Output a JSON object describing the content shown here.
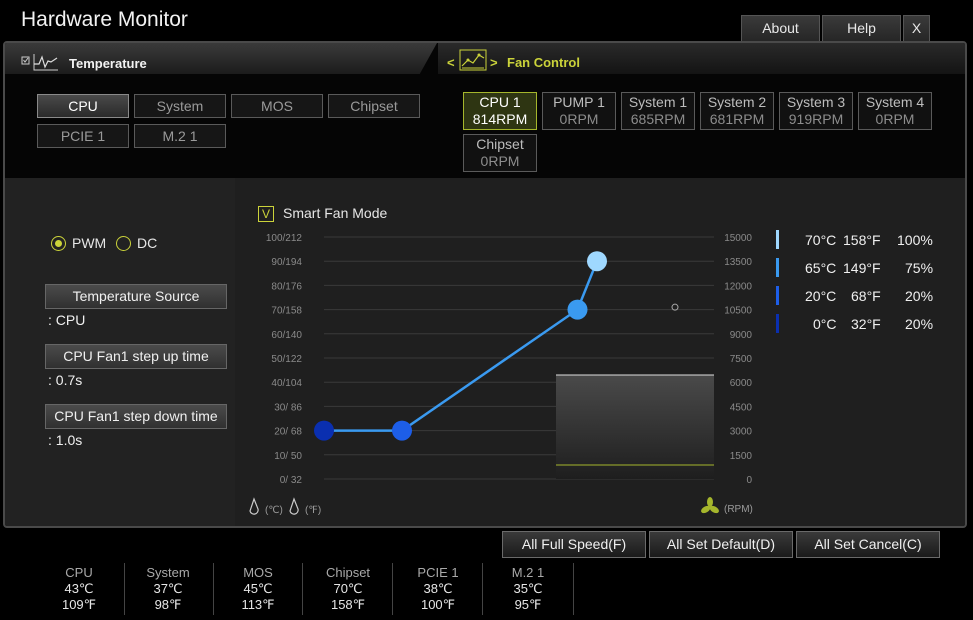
{
  "app_title": "Hardware Monitor",
  "top_buttons": {
    "about": "About",
    "help": "Help",
    "close": "X"
  },
  "temperature_tab": {
    "label": "Temperature"
  },
  "fan_control_tab": {
    "label": "Fan Control",
    "prev": "<",
    "next": ">"
  },
  "temp_sensors": [
    {
      "label": "CPU",
      "active": true
    },
    {
      "label": "System",
      "active": false
    },
    {
      "label": "MOS",
      "active": false
    },
    {
      "label": "Chipset",
      "active": false
    },
    {
      "label": "PCIE 1",
      "active": false
    },
    {
      "label": "M.2 1",
      "active": false
    }
  ],
  "fans": [
    {
      "name": "CPU 1",
      "rpm": "814RPM",
      "active": true
    },
    {
      "name": "PUMP 1",
      "rpm": "0RPM",
      "active": false
    },
    {
      "name": "System 1",
      "rpm": "685RPM",
      "active": false
    },
    {
      "name": "System 2",
      "rpm": "681RPM",
      "active": false
    },
    {
      "name": "System 3",
      "rpm": "919RPM",
      "active": false
    },
    {
      "name": "System 4",
      "rpm": "0RPM",
      "active": false
    },
    {
      "name": "Chipset",
      "rpm": "0RPM",
      "active": false
    }
  ],
  "mode": {
    "pwm": "PWM",
    "dc": "DC",
    "selected": "PWM"
  },
  "params": {
    "temp_source_label": "Temperature Source",
    "temp_source_value": ": CPU",
    "step_up_label": "CPU Fan1 step up time",
    "step_up_value": ": 0.7s",
    "step_down_label": "CPU Fan1 step down time",
    "step_down_value": ": 1.0s"
  },
  "smart_fan": {
    "check": "V",
    "label": "Smart Fan Mode",
    "checked": true
  },
  "chart_data": {
    "type": "line",
    "title": "",
    "left_ticks": [
      "100/212",
      "90/194",
      "80/176",
      "70/158",
      "60/140",
      "50/122",
      "40/104",
      "30/ 86",
      "20/ 68",
      "10/ 50",
      "0/ 32"
    ],
    "right_ticks": [
      "15000",
      "13500",
      "12000",
      "10500",
      "9000",
      "7500",
      "6000",
      "4500",
      "3000",
      "1500",
      "0"
    ],
    "left_unit_c": "(℃)",
    "left_unit_f": "(℉)",
    "right_unit": "(RPM)",
    "y_range": [
      0,
      100
    ],
    "x_range": [
      0,
      100
    ],
    "grid": true,
    "series": [
      {
        "x": [
          0,
          20,
          65,
          70
        ],
        "y": [
          20,
          20,
          70,
          90
        ],
        "colors": [
          "#0a2fb0",
          "#1d5ee8",
          "#3a9af0",
          "#9fd8ff"
        ]
      }
    ],
    "current_point": {
      "x": 90,
      "y": 71
    },
    "current_rpm_level_percent": 43
  },
  "legend": [
    {
      "c": "70°C",
      "f": "158°F",
      "pct": "100%",
      "color": "#9fd8ff"
    },
    {
      "c": "65°C",
      "f": "149°F",
      "pct": "75%",
      "color": "#3a9af0"
    },
    {
      "c": "20°C",
      "f": "68°F",
      "pct": "20%",
      "color": "#1d5ee8"
    },
    {
      "c": "0°C",
      "f": "32°F",
      "pct": "20%",
      "color": "#0a2fb0"
    }
  ],
  "bottom_buttons": {
    "full_speed": "All Full Speed(F)",
    "set_default": "All Set Default(D)",
    "set_cancel": "All Set Cancel(C)"
  },
  "bottom_temps": [
    {
      "name": "CPU",
      "c": "43℃",
      "f": "109℉"
    },
    {
      "name": "System",
      "c": "37℃",
      "f": "98℉"
    },
    {
      "name": "MOS",
      "c": "45℃",
      "f": "113℉"
    },
    {
      "name": "Chipset",
      "c": "70℃",
      "f": "158℉"
    },
    {
      "name": "PCIE 1",
      "c": "38℃",
      "f": "100℉"
    },
    {
      "name": "M.2 1",
      "c": "35℃",
      "f": "95℉"
    }
  ],
  "colors": {
    "accent": "#cbd33a",
    "fan_active_border": "#a5b62c"
  }
}
